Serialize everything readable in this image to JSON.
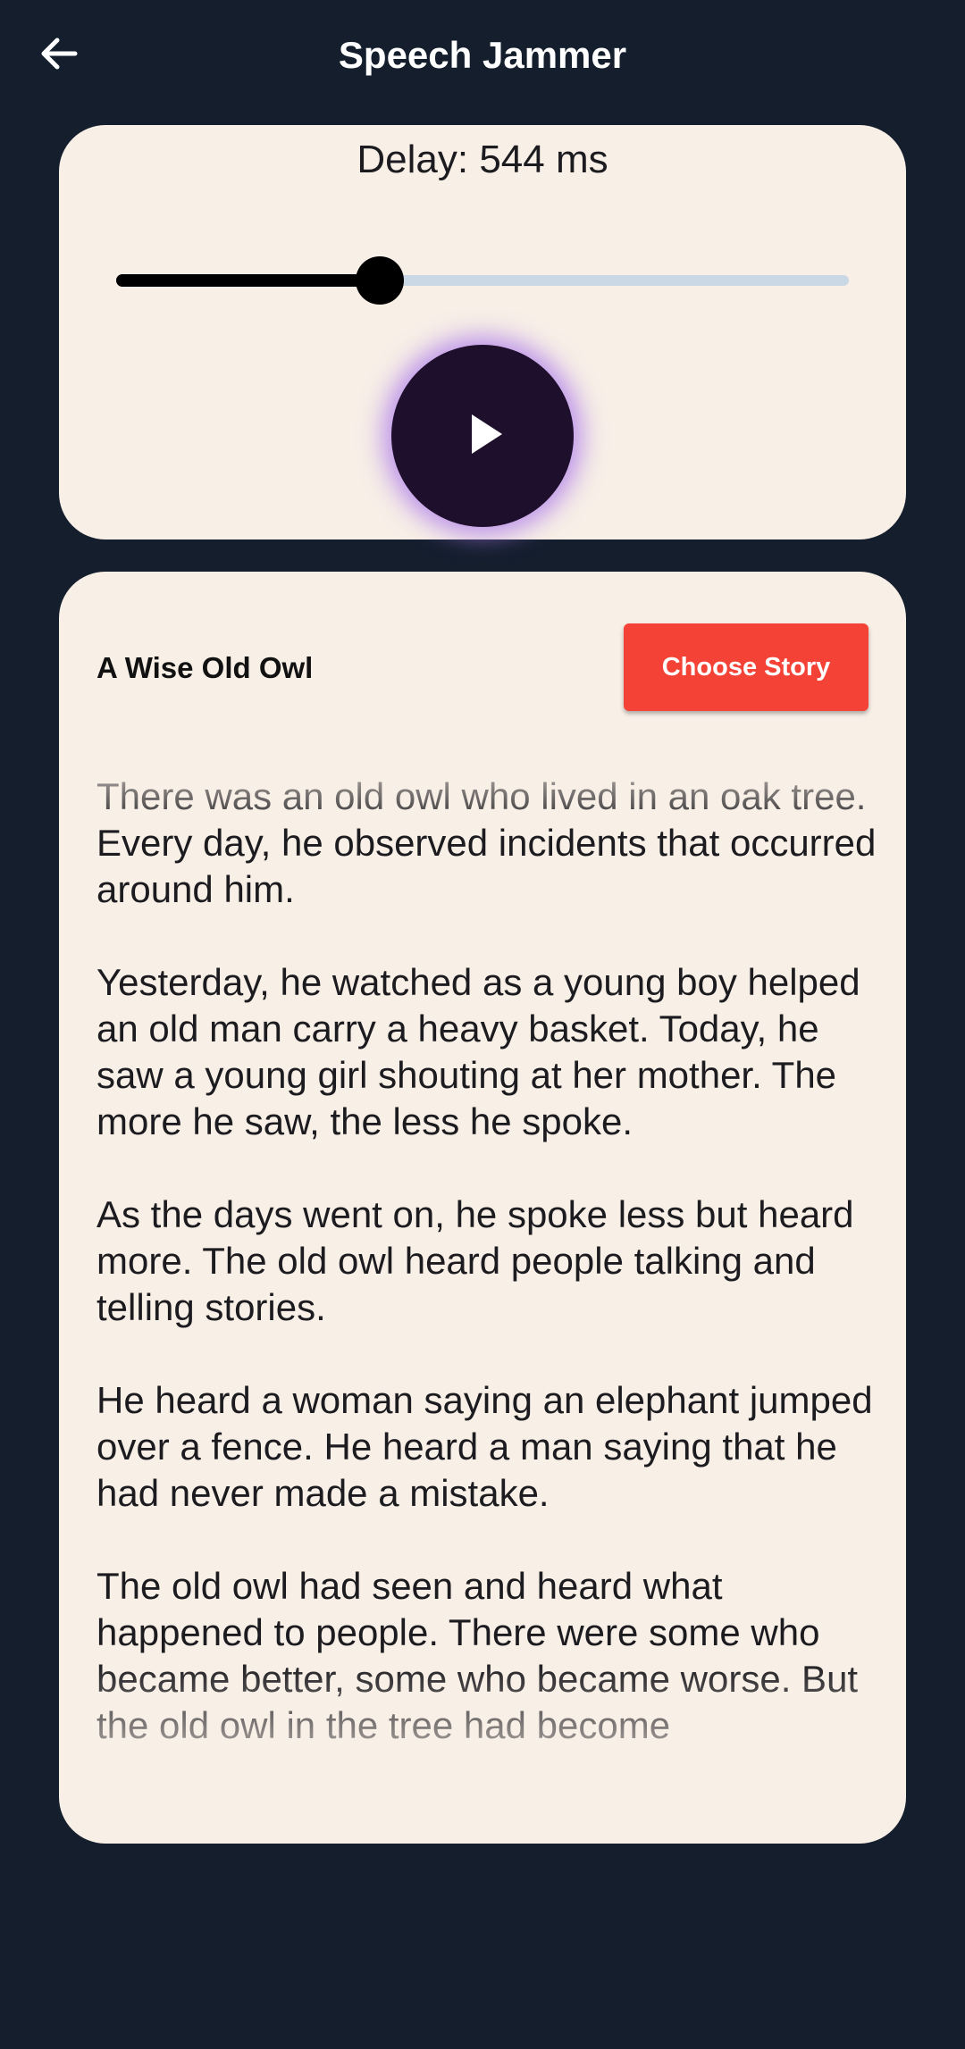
{
  "app_bar": {
    "title": "Speech Jammer",
    "back_icon": "arrow-left-icon"
  },
  "controls": {
    "delay_label": "Delay: 544 ms",
    "delay_fraction": 0.36,
    "play_icon": "play-icon",
    "colors": {
      "slider_active": "#000000",
      "slider_inactive": "#cad8e6",
      "play_button": "#1e0f2c",
      "glow": "#aa78eb"
    }
  },
  "story": {
    "title": "A Wise Old Owl",
    "choose_label": "Choose Story",
    "choose_color": "#f44336",
    "paragraphs": [
      "There was an old owl who lived in an oak tree. Every day, he observed incidents that occurred around him.",
      "Yesterday, he watched as a young boy helped an old man carry a heavy basket. Today, he saw a young girl shouting at her mother. The more he saw, the less he spoke.",
      "As the days went on, he spoke less but heard more. The old owl heard people talking and telling stories.",
      "He heard a woman saying an elephant jumped over a fence. He heard a man saying that he had never made a mistake.",
      "The old owl had seen and heard what happened to people. There were some who became better, some who became worse. But the old owl in the tree had become"
    ]
  }
}
